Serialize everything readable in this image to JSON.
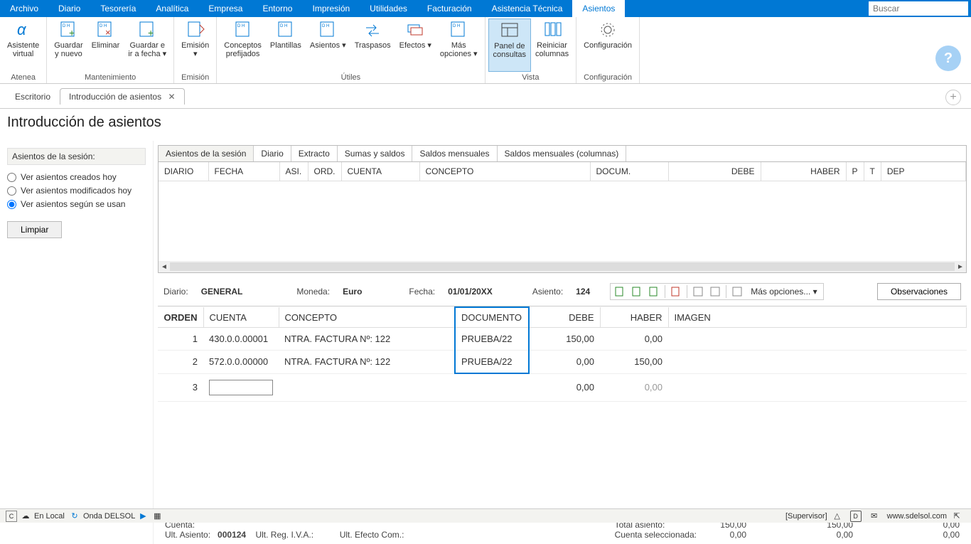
{
  "menubar": [
    "Archivo",
    "Diario",
    "Tesorería",
    "Analítica",
    "Empresa",
    "Entorno",
    "Impresión",
    "Utilidades",
    "Facturación",
    "Asistencia Técnica",
    "Asientos"
  ],
  "menubar_active": "Asientos",
  "search_placeholder": "Buscar",
  "ribbon": {
    "groups": [
      {
        "label": "Atenea",
        "items": [
          {
            "label": "Asistente\nvirtual",
            "icon": "alpha"
          }
        ]
      },
      {
        "label": "Mantenimiento",
        "items": [
          {
            "label": "Guardar\ny nuevo",
            "icon": "doc-plus"
          },
          {
            "label": "Eliminar",
            "icon": "doc-x"
          },
          {
            "label": "Guardar e\nir a fecha ▾",
            "icon": "doc-plus"
          }
        ]
      },
      {
        "label": "Emisión",
        "items": [
          {
            "label": "Emisión\n▾",
            "icon": "doc-arrow"
          }
        ]
      },
      {
        "label": "Útiles",
        "items": [
          {
            "label": "Conceptos\nprefijados",
            "icon": "doc-dh"
          },
          {
            "label": "Plantillas",
            "icon": "doc-dh"
          },
          {
            "label": "Asientos ▾",
            "icon": "doc-dh"
          },
          {
            "label": "Traspasos",
            "icon": "swap"
          },
          {
            "label": "Efectos ▾",
            "icon": "cards"
          },
          {
            "label": "Más\nopciones ▾",
            "icon": "doc-dh"
          }
        ]
      },
      {
        "label": "Vista",
        "items": [
          {
            "label": "Panel de\nconsultas",
            "icon": "panel",
            "active": true
          },
          {
            "label": "Reiniciar\ncolumnas",
            "icon": "cols"
          }
        ]
      },
      {
        "label": "Configuración",
        "items": [
          {
            "label": "Configuración",
            "icon": "gear"
          }
        ]
      }
    ]
  },
  "doc_tabs": [
    {
      "label": "Escritorio",
      "active": false
    },
    {
      "label": "Introducción de asientos",
      "active": true,
      "close": true
    }
  ],
  "page_title": "Introducción de asientos",
  "left_panel": {
    "session_label": "Asientos de la sesión:",
    "radios": [
      {
        "label": "Ver asientos creados hoy",
        "checked": false
      },
      {
        "label": "Ver asientos modificados hoy",
        "checked": false
      },
      {
        "label": "Ver asientos según se usan",
        "checked": true
      }
    ],
    "limpiar": "Limpiar"
  },
  "inner_tabs": [
    "Asientos de la sesión",
    "Diario",
    "Extracto",
    "Sumas y saldos",
    "Saldos mensuales",
    "Saldos mensuales (columnas)"
  ],
  "inner_tab_active": "Asientos de la sesión",
  "upper_columns": [
    "DIARIO",
    "FECHA",
    "ASI.",
    "ORD.",
    "CUENTA",
    "CONCEPTO",
    "DOCUM.",
    "DEBE",
    "HABER",
    "P",
    "T",
    "DEP"
  ],
  "entry_info": {
    "diario_lbl": "Diario:",
    "diario_val": "GENERAL",
    "moneda_lbl": "Moneda:",
    "moneda_val": "Euro",
    "fecha_lbl": "Fecha:",
    "fecha_val": "01/01/20XX",
    "asiento_lbl": "Asiento:",
    "asiento_val": "124",
    "more": "Más opciones... ▾",
    "obs": "Observaciones"
  },
  "lower_columns": [
    "ORDEN",
    "CUENTA",
    "CONCEPTO",
    "DOCUMENTO",
    "DEBE",
    "HABER",
    "IMAGEN"
  ],
  "lower_rows": [
    {
      "orden": "1",
      "cuenta": "430.0.0.00001",
      "concepto": "NTRA. FACTURA Nº:  122",
      "documento": "PRUEBA/22",
      "debe": "150,00",
      "haber": "0,00"
    },
    {
      "orden": "2",
      "cuenta": "572.0.0.00000",
      "concepto": "NTRA. FACTURA Nº:  122",
      "documento": "PRUEBA/22",
      "debe": "0,00",
      "haber": "150,00"
    },
    {
      "orden": "3",
      "cuenta": "",
      "concepto": "",
      "documento": "",
      "debe": "0,00",
      "haber": "0,00",
      "input": true,
      "grey_haber": true
    }
  ],
  "footer": {
    "cuenta_lbl": "Cuenta:",
    "ult_asiento_lbl": "Ult. Asiento:",
    "ult_asiento_val": "000124",
    "ult_reg_iva": "Ult. Reg. I.V.A.:",
    "ult_efecto": "Ult. Efecto Com.:",
    "total_lbl": "Total asiento:",
    "cuenta_sel_lbl": "Cuenta seleccionada:",
    "totals": {
      "debe": "150,00",
      "haber": "150,00",
      "diff": "0,00",
      "sel_debe": "0,00",
      "sel_haber": "0,00",
      "sel_diff": "0,00"
    }
  },
  "status": {
    "local": "En Local",
    "onda": "Onda DELSOL",
    "supervisor": "[Supervisor]",
    "url": "www.sdelsol.com"
  }
}
